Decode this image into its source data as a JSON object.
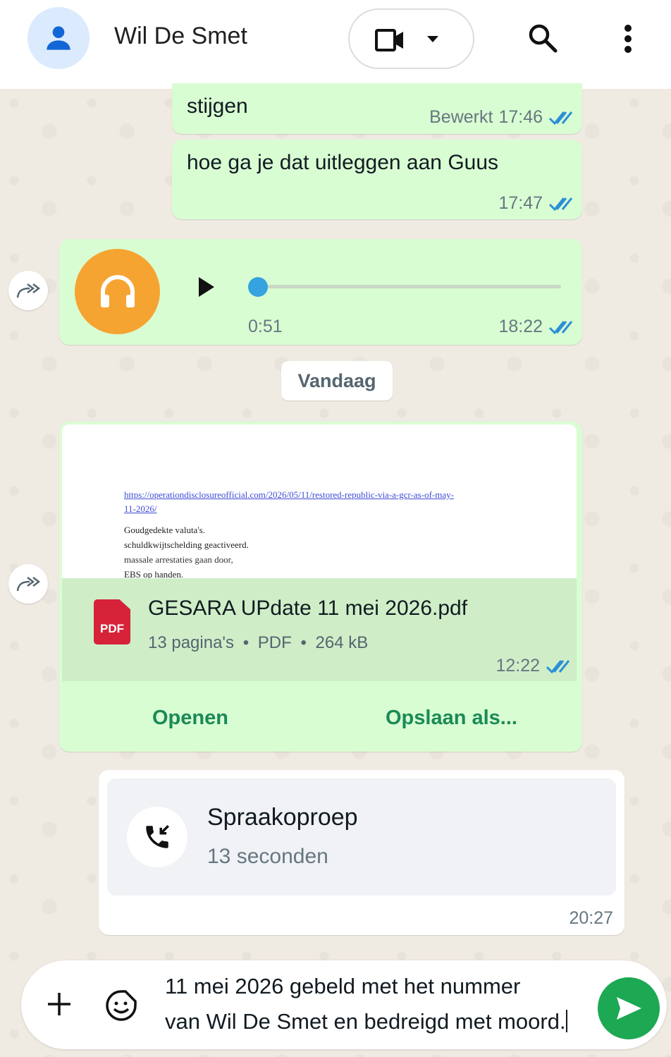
{
  "header": {
    "contact_name": "Wil De Smet",
    "icons": [
      "person-icon",
      "video-icon",
      "caret-down-icon",
      "search-icon",
      "more-vert-icon"
    ]
  },
  "messages": [
    {
      "text": "stijgen",
      "edited_label": "Bewerkt",
      "time": "17:46",
      "status": "read"
    },
    {
      "text": "hoe ga je dat uitleggen aan Guus",
      "time": "17:47",
      "status": "read"
    },
    {
      "type": "audio",
      "duration": "0:51",
      "time": "18:22",
      "status": "read",
      "progress": 0
    }
  ],
  "date_separator": "Vandaag",
  "document": {
    "preview": {
      "link": "https://operationdisclosureofficial.com/2026/05/11/restored-republic-via-a-gcr-as-of-may-",
      "link2": "11-2026/",
      "lines": [
        "Goudgedekte valuta's.",
        "schuldkwijtschelding geactiveerd.",
        "massale arrestaties gaan door,",
        "EBS op handen."
      ]
    },
    "badge": "PDF",
    "name": "GESARA UPdate 11 mei 2026.pdf",
    "pages": "13 pagina's",
    "format": "PDF",
    "size": "264 kB",
    "separator": "•",
    "time": "12:22",
    "status": "read",
    "open_label": "Openen",
    "save_label": "Opslaan als..."
  },
  "call": {
    "title": "Spraakoproep",
    "duration": "13 seconden",
    "time": "20:27"
  },
  "composer": {
    "text_line1": "11 mei 2026 gebeld met het nummer",
    "text_line2": "van Wil De Smet en bedreigd met moord."
  },
  "colors": {
    "outgoing_bubble": "#d9fdd3",
    "tick_blue": "#53bdeb",
    "send_green": "#1da854",
    "audio_avatar": "#f6a431",
    "action_green": "#1a8a56"
  }
}
